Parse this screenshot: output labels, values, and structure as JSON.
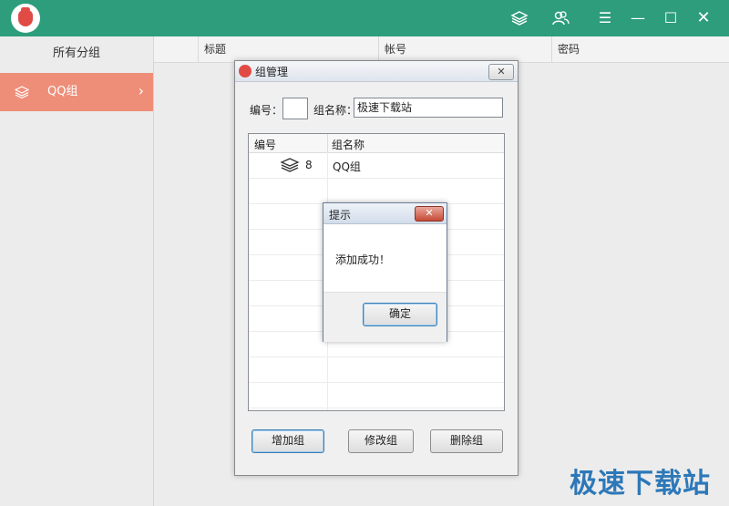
{
  "topbar": {
    "icons": [
      "layers-icon",
      "users-icon",
      "menu-icon",
      "minimize-icon",
      "maximize-icon",
      "close-icon"
    ]
  },
  "sidebar": {
    "title": "所有分组",
    "items": [
      {
        "label": "QQ组",
        "icon": "layers-icon"
      }
    ]
  },
  "main": {
    "columns": [
      "标题",
      "帐号",
      "密码"
    ]
  },
  "group_dialog": {
    "title": "组管理",
    "id_label": "编号：",
    "id_value": "",
    "name_label": "组名称：",
    "name_value": "极速下载站",
    "grid": {
      "headers": [
        "编号",
        "组名称"
      ],
      "rows": [
        {
          "id": "8",
          "name": "QQ组"
        }
      ]
    },
    "buttons": {
      "add": "增加组",
      "edit": "修改组",
      "delete": "删除组"
    }
  },
  "message_box": {
    "title": "提示",
    "text": "添加成功！",
    "ok": "确定"
  },
  "watermark": "极速下载站",
  "colors": {
    "topbar": "#2e9d7b",
    "sidebar_selected": "#ee8e78",
    "watermark": "#2d78b8"
  }
}
